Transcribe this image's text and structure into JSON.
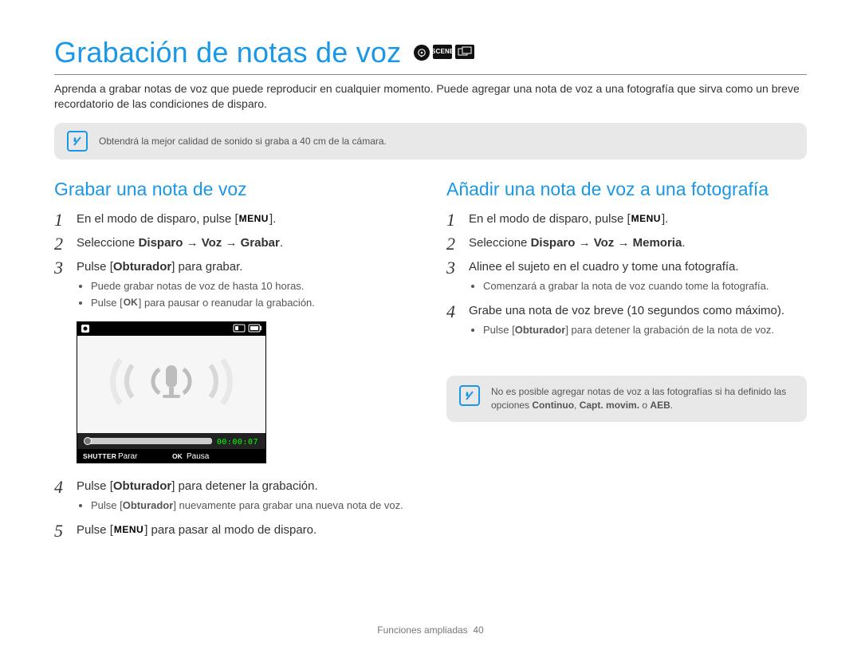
{
  "title": "Grabación de notas de voz",
  "mode_icons": [
    "P",
    "SCENE",
    "DUAL"
  ],
  "intro": "Aprenda a grabar notas de voz que puede reproducir en cualquier momento. Puede agregar una nota de voz a una fotografía que sirva como un breve recordatorio de las condiciones de disparo.",
  "tip1": "Obtendrá la mejor calidad de sonido si graba a 40 cm de la cámara.",
  "left": {
    "heading": "Grabar una nota de voz",
    "steps": {
      "s1_a": "En el modo de disparo, pulse [",
      "s1_menu": "MENU",
      "s1_b": "].",
      "s2_a": "Seleccione ",
      "s2_path": "Disparo → Voz → Grabar",
      "s2_b": ".",
      "s3_a": "Pulse [",
      "s3_b": "Obturador",
      "s3_c": "] para grabar.",
      "s3_bullets": {
        "a": "Puede grabar notas de voz de hasta 10 horas.",
        "b_a": "Pulse [",
        "b_ok": "OK",
        "b_b": "] para pausar o reanudar la grabación."
      },
      "s4_a": "Pulse [",
      "s4_b": "Obturador",
      "s4_c": "] para detener la grabación.",
      "s4_bullets": {
        "a_a": "Pulse [",
        "a_b": "Obturador",
        "a_c": "] nuevamente para grabar una nueva nota de voz."
      },
      "s5_a": "Pulse [",
      "s5_menu": "MENU",
      "s5_b": "] para pasar al modo de disparo."
    }
  },
  "right": {
    "heading": "Añadir una nota de voz a una fotografía",
    "steps": {
      "s1_a": "En el modo de disparo, pulse [",
      "s1_menu": "MENU",
      "s1_b": "].",
      "s2_a": "Seleccione ",
      "s2_path": "Disparo → Voz → Memoria",
      "s2_b": ".",
      "s3": "Alinee el sujeto en el cuadro y tome una fotografía.",
      "s3_bullet": "Comenzará a grabar la nota de voz cuando tome la fotografía.",
      "s4": "Grabe una nota de voz breve (10 segundos como máximo).",
      "s4_bullet_a": "Pulse [",
      "s4_bullet_b": "Obturador",
      "s4_bullet_c": "] para detener la grabación de la nota de voz."
    },
    "tip2_a": "No es posible agregar notas de voz a las fotografías si ha definido las opciones ",
    "tip2_b1": "Continuo",
    "tip2_c": ", ",
    "tip2_b2": "Capt. movim.",
    "tip2_d": " o ",
    "tip2_b3": "AEB",
    "tip2_e": "."
  },
  "screen": {
    "time": "00:00:07",
    "stop": "Parar",
    "pause": "Pausa",
    "shutter": "SHUTTER",
    "ok": "OK"
  },
  "footer": {
    "section": "Funciones ampliadas",
    "page": "40"
  }
}
